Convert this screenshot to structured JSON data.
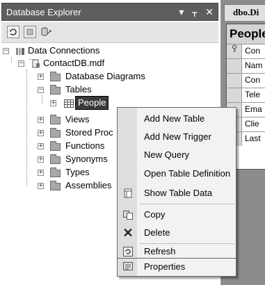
{
  "panel": {
    "title": "Database Explorer",
    "title_buttons": [
      "▾",
      "ᚁ",
      "✕"
    ],
    "toolbar_icons": [
      "refresh-icon",
      "stop-icon",
      "connect-icon"
    ]
  },
  "tree": {
    "data_connections": "Data Connections",
    "db_file": "ContactDB.mdf",
    "database_diagrams": "Database Diagrams",
    "tables": "Tables",
    "people": "People",
    "views": "Views",
    "stored_procedures": "Stored Proc",
    "functions": "Functions",
    "synonyms": "Synonyms",
    "types": "Types",
    "assemblies": "Assemblies"
  },
  "document": {
    "tab_title": "dbo.Di",
    "table_title": "People",
    "columns": [
      "Con",
      "Nam",
      "Con",
      "Tele",
      "Ema",
      "Clie",
      "Last"
    ],
    "key_marker": "🔑"
  },
  "context_menu": {
    "items": [
      {
        "label": "Add New Table",
        "icon": ""
      },
      {
        "label": "Add New Trigger",
        "icon": ""
      },
      {
        "label": "New Query",
        "icon": ""
      },
      {
        "label": "Open Table Definition",
        "icon": ""
      },
      {
        "label": "Show Table Data",
        "icon": "show-table-data-icon"
      },
      {
        "label": "Copy",
        "icon": "copy-icon"
      },
      {
        "label": "Delete",
        "icon": "delete-icon"
      },
      {
        "label": "Refresh",
        "icon": "refresh-icon"
      },
      {
        "label": "Properties",
        "icon": "properties-icon"
      }
    ]
  }
}
